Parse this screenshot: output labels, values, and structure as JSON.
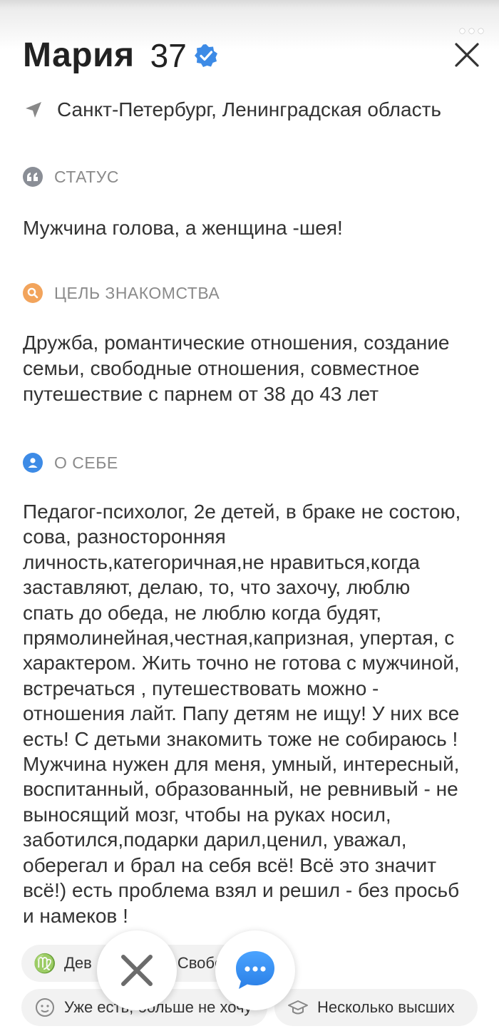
{
  "profile": {
    "name": "Мария",
    "age": "37",
    "location": "Санкт-Петербург, Ленинградская область"
  },
  "sections": {
    "status": {
      "title": "СТАТУС",
      "text": "Мужчина голова, а женщина -шея!"
    },
    "goal": {
      "title": "ЦЕЛЬ ЗНАКОМСТВА",
      "text": "Дружба, романтические отношения, создание\nсемьи, свободные отношения, совместное\nпутешествие с парнем от 38 до 43 лет"
    },
    "about": {
      "title": "О СЕБЕ",
      "text": "Педагог-психолог, 2е детей, в браке не состою,\nсова,  разносторонняя\nличность,категоричная,не нравиться,когда\nзаставляют, делаю, то, что захочу, люблю\nспать до обеда, не люблю когда будят,\nпрямолинейная,честная,капризная, упертая, с\nхарактером. Жить точно не готова с мужчиной,\nвстречаться , путешествовать можно -\nотношения лайт. Папу детям не ищу! У них все\nесть! С детьми знакомить тоже не собираюсь !\nМужчина  нужен для меня, умный, интересный,\nвоспитанный, образованный, не ревнивый - не\nвыносящий мозг, чтобы на руках носил,\nзаботился,подарки дарил,ценил, уважал,\nоберегал и брал на себя всё! Всё это значит\nвсё!) есть проблема взял и решил - без просьб\nи намеков !"
    }
  },
  "tags": {
    "zodiac": "Дев",
    "relationship": "Свобо",
    "children": "Уже есть, больше не хочу",
    "education": "Несколько высших"
  },
  "icons": {
    "verified": "verified-check-icon",
    "close": "close-icon",
    "location": "location-arrow-icon",
    "status": "quote-icon",
    "goal": "search-icon",
    "about": "person-icon",
    "zodiac": "virgo-icon",
    "children": "baby-face-icon",
    "education": "graduation-cap-icon",
    "dislike": "dislike-x-icon",
    "message": "chat-bubble-icon"
  },
  "colors": {
    "verified": "#3d8be6",
    "status_icon": "#8a8e96",
    "goal_icon": "#f2a45c",
    "about_icon": "#3d8be6",
    "message": "#2f8ff0",
    "dislike": "#6b6b6b"
  }
}
